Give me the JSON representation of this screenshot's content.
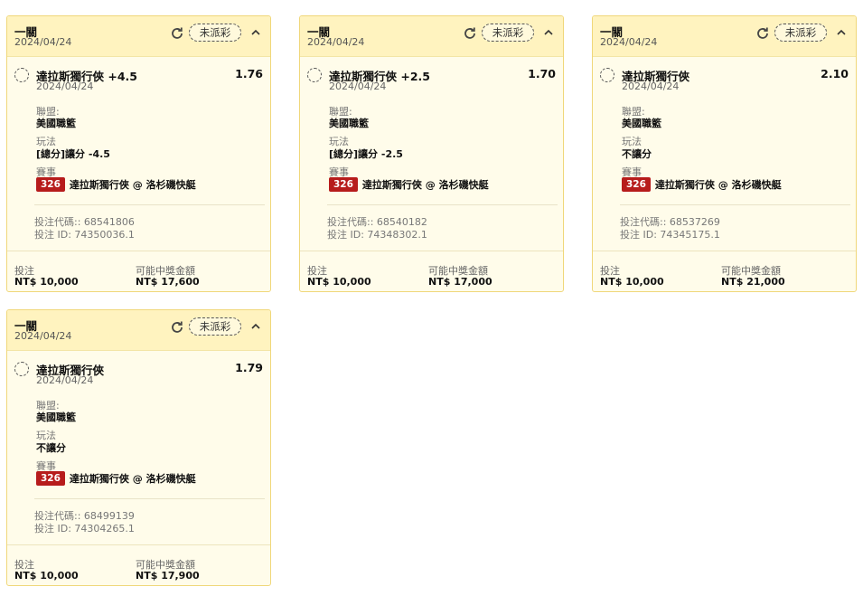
{
  "labels": {
    "league": "聯盟:",
    "play": "玩法",
    "event": "賽事",
    "bet_code": "投注代碼::",
    "bet_id": "投注 ID:",
    "stake": "投注",
    "potential_win": "可能中獎金額"
  },
  "cards": [
    {
      "title": "一關",
      "date": "2024/04/24",
      "status": "未派彩",
      "selection": "達拉斯獨行俠 +4.5",
      "odds": "1.76",
      "selection_date": "2024/04/24",
      "league": "美國職籃",
      "play": "[總分]讓分 -4.5",
      "event_id": "326",
      "event_name": "達拉斯獨行俠 @ 洛杉磯快艇",
      "bet_code": "68541806",
      "bet_id": "74350036.1",
      "stake": "NT$ 10,000",
      "potential_win": "NT$ 17,600"
    },
    {
      "title": "一關",
      "date": "2024/04/24",
      "status": "未派彩",
      "selection": "達拉斯獨行俠 +2.5",
      "odds": "1.70",
      "selection_date": "2024/04/24",
      "league": "美國職籃",
      "play": "[總分]讓分 -2.5",
      "event_id": "326",
      "event_name": "達拉斯獨行俠 @ 洛杉磯快艇",
      "bet_code": "68540182",
      "bet_id": "74348302.1",
      "stake": "NT$ 10,000",
      "potential_win": "NT$ 17,000"
    },
    {
      "title": "一關",
      "date": "2024/04/24",
      "status": "未派彩",
      "selection": "達拉斯獨行俠",
      "odds": "2.10",
      "selection_date": "2024/04/24",
      "league": "美國職籃",
      "play": "不讓分",
      "event_id": "326",
      "event_name": "達拉斯獨行俠 @ 洛杉磯快艇",
      "bet_code": "68537269",
      "bet_id": "74345175.1",
      "stake": "NT$ 10,000",
      "potential_win": "NT$ 21,000"
    },
    {
      "title": "一關",
      "date": "2024/04/24",
      "status": "未派彩",
      "selection": "達拉斯獨行俠",
      "odds": "1.79",
      "selection_date": "2024/04/24",
      "league": "美國職籃",
      "play": "不讓分",
      "event_id": "326",
      "event_name": "達拉斯獨行俠 @ 洛杉磯快艇",
      "bet_code": "68499139",
      "bet_id": "74304265.1",
      "stake": "NT$ 10,000",
      "potential_win": "NT$ 17,900"
    }
  ],
  "icons": {
    "refresh": "refresh-icon",
    "collapse": "chevron-up-icon",
    "select": "dashed-circle-icon"
  },
  "colors": {
    "header_bg": "#fff3bf",
    "card_bg": "#fffcea",
    "border": "#f0d77a",
    "event_badge": "#b71c1c"
  }
}
